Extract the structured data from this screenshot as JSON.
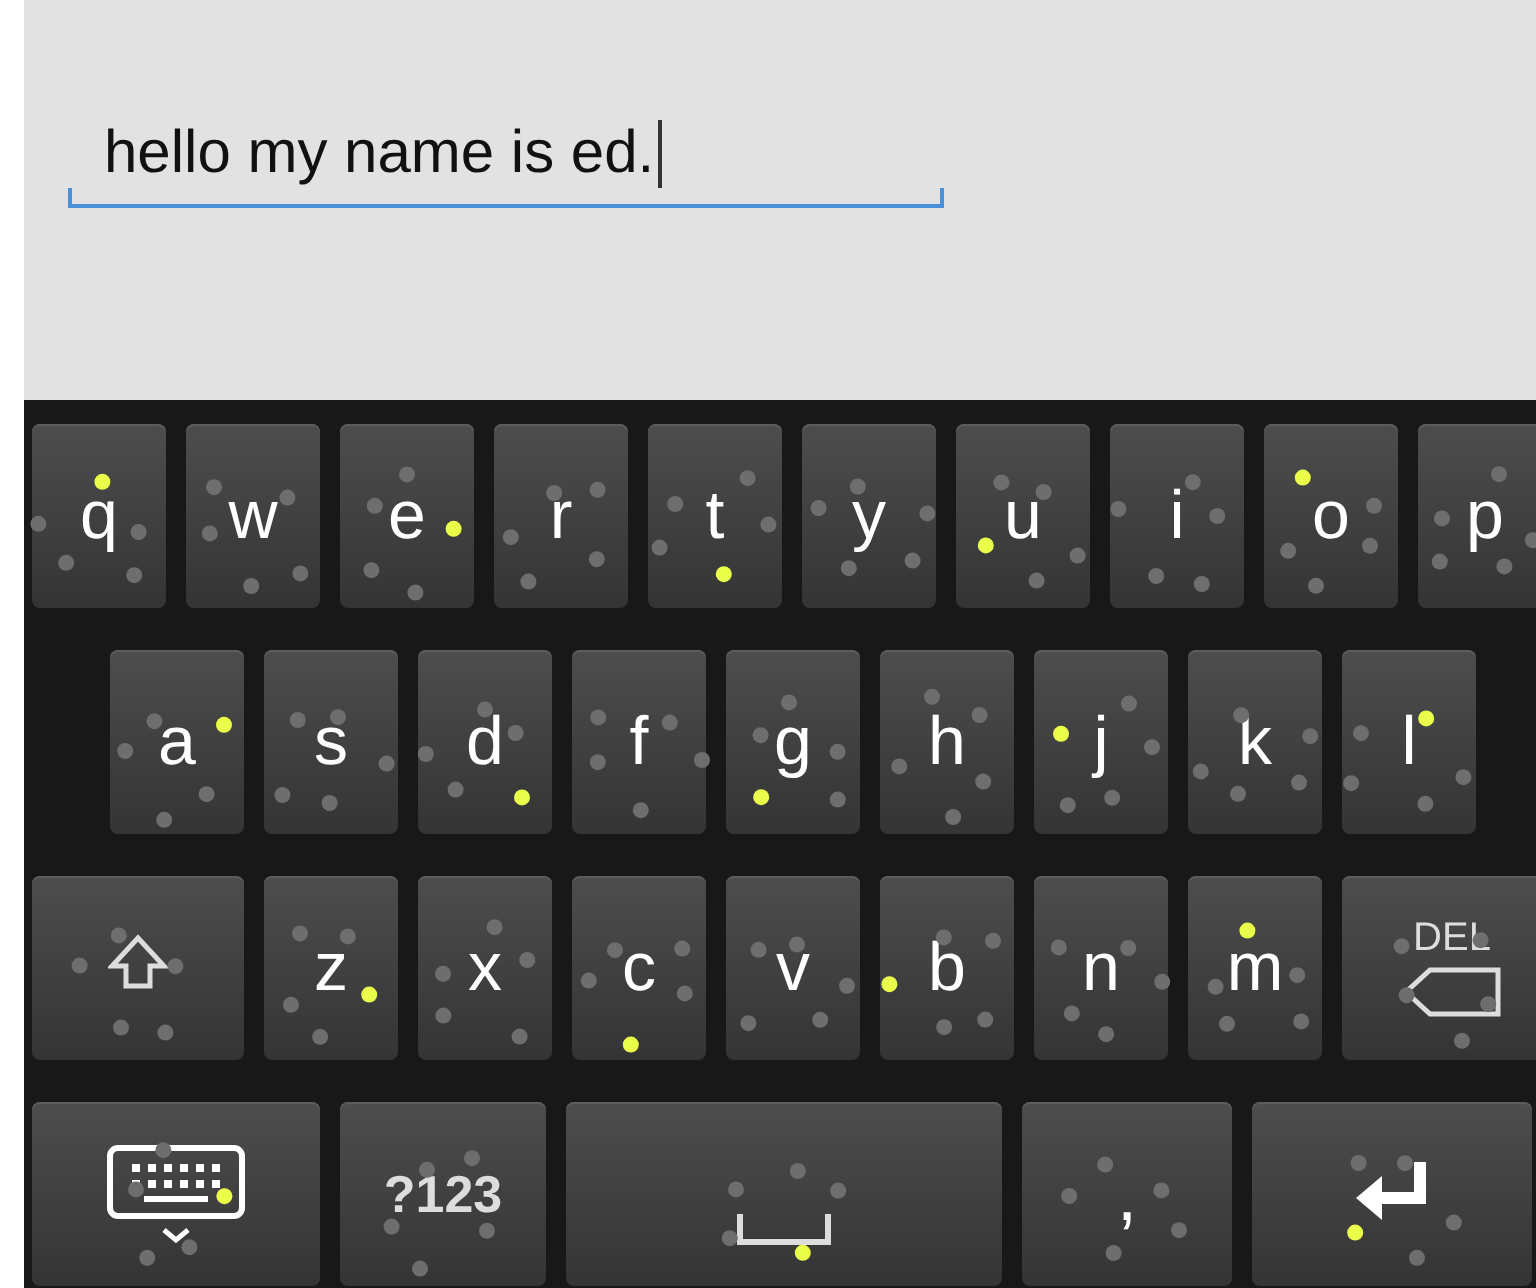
{
  "text_field": {
    "value": "hello my name is ed.",
    "focused": true
  },
  "keyboard": {
    "top_row": [
      {
        "kind": "letter",
        "label": "q"
      },
      {
        "kind": "letter",
        "label": "w"
      },
      {
        "kind": "letter",
        "label": "e"
      },
      {
        "kind": "letter",
        "label": "r"
      },
      {
        "kind": "letter",
        "label": "t"
      },
      {
        "kind": "letter",
        "label": "y"
      },
      {
        "kind": "letter",
        "label": "u"
      },
      {
        "kind": "letter",
        "label": "i"
      },
      {
        "kind": "letter",
        "label": "o"
      },
      {
        "kind": "letter",
        "label": "p"
      }
    ],
    "home_row": [
      {
        "kind": "letter",
        "label": "a"
      },
      {
        "kind": "letter",
        "label": "s"
      },
      {
        "kind": "letter",
        "label": "d"
      },
      {
        "kind": "letter",
        "label": "f"
      },
      {
        "kind": "letter",
        "label": "g"
      },
      {
        "kind": "letter",
        "label": "h"
      },
      {
        "kind": "letter",
        "label": "j"
      },
      {
        "kind": "letter",
        "label": "k"
      },
      {
        "kind": "letter",
        "label": "l"
      }
    ],
    "bottom_row": [
      {
        "kind": "shift"
      },
      {
        "kind": "letter",
        "label": "z"
      },
      {
        "kind": "letter",
        "label": "x"
      },
      {
        "kind": "letter",
        "label": "c"
      },
      {
        "kind": "letter",
        "label": "v"
      },
      {
        "kind": "letter",
        "label": "b"
      },
      {
        "kind": "letter",
        "label": "n"
      },
      {
        "kind": "letter",
        "label": "m"
      },
      {
        "kind": "delete",
        "label": "DEL"
      }
    ],
    "function_row": [
      {
        "kind": "keyboard"
      },
      {
        "kind": "symbols",
        "label": "?123"
      },
      {
        "kind": "space"
      },
      {
        "kind": "comma",
        "label": ","
      },
      {
        "kind": "enter"
      }
    ]
  }
}
